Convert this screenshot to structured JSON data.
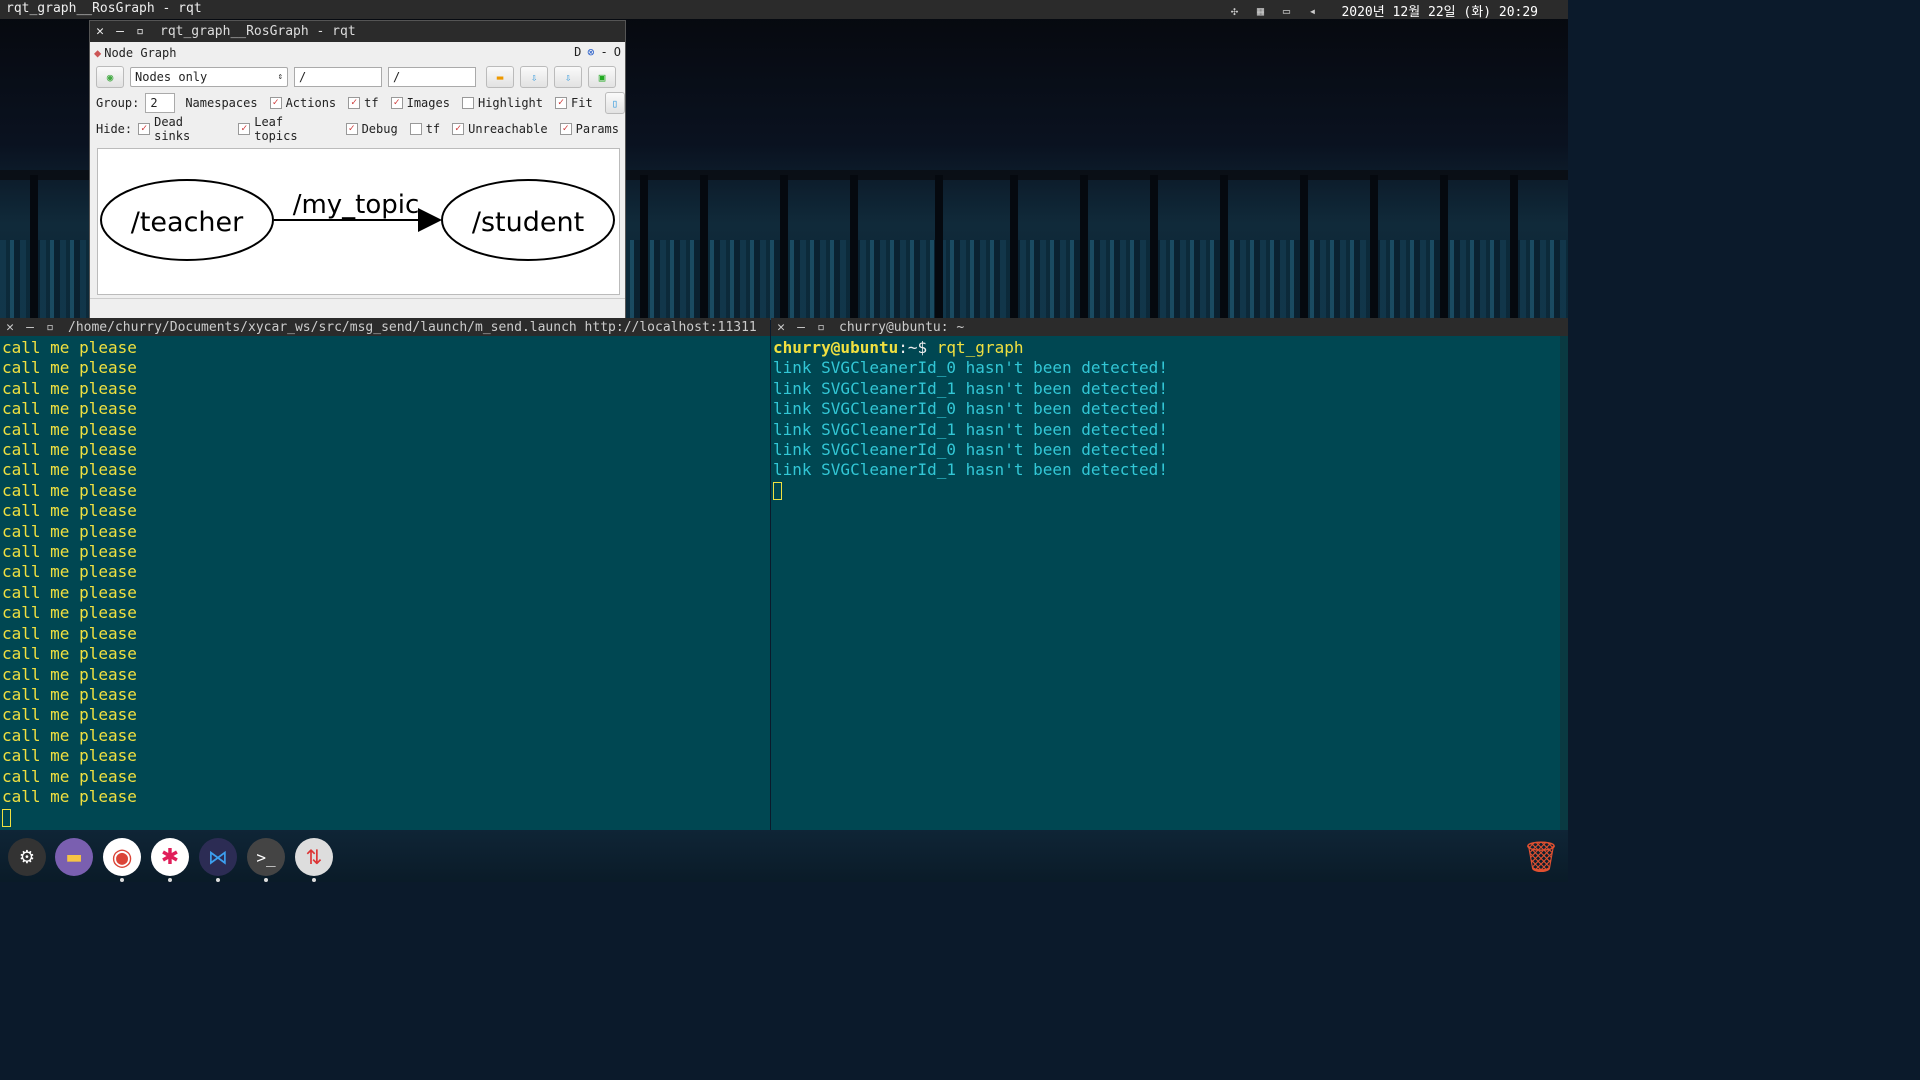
{
  "topbar": {
    "window_title": "rqt_graph__RosGraph - rqt",
    "clock": "2020년 12월 22일 (화) 20:29",
    "tray_icons": [
      "network-icon",
      "keyboard-icon",
      "display-icon",
      "volume-icon"
    ]
  },
  "rqt": {
    "title": "rqt_graph__RosGraph - rqt",
    "plugin_title": "Node Graph",
    "plugin_controls": [
      "D",
      "⊗",
      "-",
      "O"
    ],
    "mode_combo": "Nodes only",
    "ns_filter": "/",
    "topic_filter": "/",
    "group_label": "Group:",
    "group_value": "2",
    "namespaces_label": "Namespaces",
    "actions_label": "Actions",
    "tf_label": "tf",
    "images_label": "Images",
    "highlight_label": "Highlight",
    "fit_label": "Fit",
    "hide_label": "Hide:",
    "dead_sinks_label": "Dead sinks",
    "leaf_topics_label": "Leaf topics",
    "debug_label": "Debug",
    "hide_tf_label": "tf",
    "unreachable_label": "Unreachable",
    "params_label": "Params",
    "graph": {
      "node_a": "/teacher",
      "node_b": "/student",
      "edge": "/my_topic"
    }
  },
  "left_terminal": {
    "title": "/home/churry/Documents/xycar_ws/src/msg_send/launch/m_send.launch http://localhost:11311",
    "lines": [
      "call me please",
      "call me please",
      "call me please",
      "call me please",
      "call me please",
      "call me please",
      "call me please",
      "call me please",
      "call me please",
      "call me please",
      "call me please",
      "call me please",
      "call me please",
      "call me please",
      "call me please",
      "call me please",
      "call me please",
      "call me please",
      "call me please",
      "call me please",
      "call me please",
      "call me please",
      "call me please"
    ]
  },
  "right_terminal": {
    "title": "churry@ubuntu: ~",
    "prompt_user": "churry@ubuntu",
    "prompt_path": ":~$",
    "command": " rqt_graph",
    "lines": [
      "link SVGCleanerId_0 hasn't been detected!",
      "link SVGCleanerId_1 hasn't been detected!",
      "link SVGCleanerId_0 hasn't been detected!",
      "link SVGCleanerId_1 hasn't been detected!",
      "link SVGCleanerId_0 hasn't been detected!",
      "link SVGCleanerId_1 hasn't been detected!"
    ]
  },
  "dock": {
    "apps": [
      "settings-icon",
      "files-icon",
      "chrome-icon",
      "slack-icon",
      "vscode-icon",
      "terminal-icon",
      "transmission-icon"
    ],
    "trash": "trash-icon"
  }
}
